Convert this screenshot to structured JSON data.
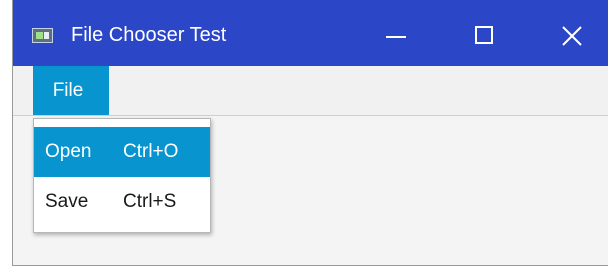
{
  "window": {
    "title": "File Chooser Test",
    "controls": {
      "minimize": "minimize",
      "maximize": "maximize",
      "close": "close"
    }
  },
  "menubar": {
    "items": [
      {
        "label": "File"
      }
    ]
  },
  "file_menu": {
    "items": [
      {
        "label": "Open",
        "shortcut": "Ctrl+O",
        "highlighted": true
      },
      {
        "label": "Save",
        "shortcut": "Ctrl+S",
        "highlighted": false
      }
    ]
  },
  "icons": {
    "app": "application-icon",
    "minimize": "minimize-icon",
    "maximize": "maximize-icon",
    "close": "close-icon"
  },
  "colors": {
    "titlebar": "#2b46c7",
    "accent": "#0895cf",
    "menubar": "#f1f1f1",
    "content": "#f4f4f4"
  }
}
